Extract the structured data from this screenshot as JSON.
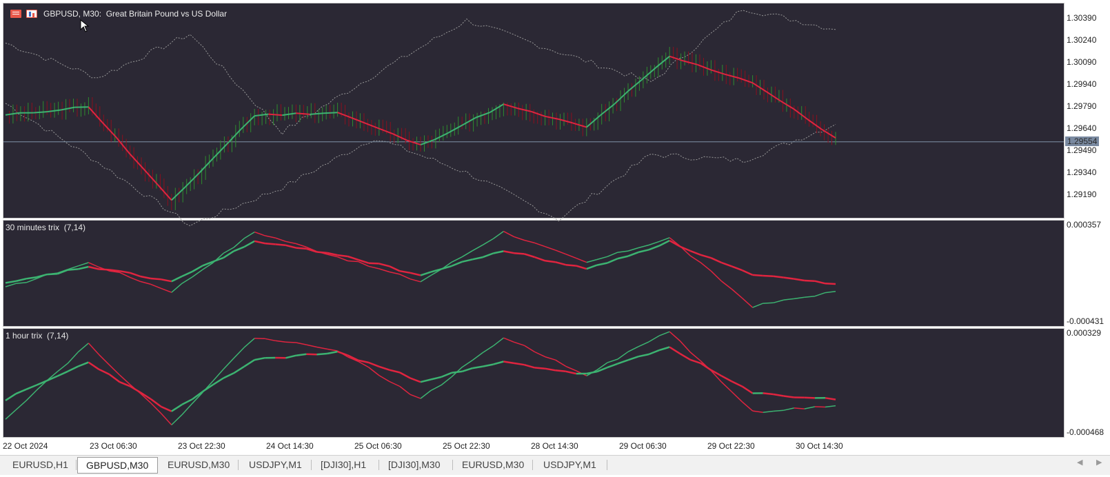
{
  "chart_title": "GBPUSD, M30:  Great Britain Pound vs US Dollar",
  "main_pane": {
    "price_labels": [
      "1.30390",
      "1.30240",
      "1.30090",
      "1.29940",
      "1.29790",
      "1.29640",
      "1.29490",
      "1.29340",
      "1.29190"
    ],
    "current_price": "1.29554"
  },
  "indicator_1": {
    "label": "30 minutes trix  (7,14)",
    "max_label": "0.000357",
    "min_label": "-0.000431"
  },
  "indicator_2": {
    "label": "1 hour trix  (7,14)",
    "max_label": "0.000329",
    "min_label": "-0.000468"
  },
  "time_labels": [
    "22 Oct 2024",
    "23 Oct 06:30",
    "23 Oct 22:30",
    "24 Oct 14:30",
    "25 Oct 06:30",
    "25 Oct 22:30",
    "28 Oct 14:30",
    "29 Oct 06:30",
    "29 Oct 22:30",
    "30 Oct 14:30"
  ],
  "tabs": [
    {
      "label": "EURUSD,H1",
      "active": false
    },
    {
      "label": "GBPUSD,M30",
      "active": true
    },
    {
      "label": "EURUSD,M30",
      "active": false
    },
    {
      "label": "USDJPY,M1",
      "active": false
    },
    {
      "label": "[DJI30],H1",
      "active": false
    },
    {
      "label": "[DJI30],M30",
      "active": false
    },
    {
      "label": "EURUSD,M30",
      "active": false
    },
    {
      "label": "USDJPY,M1",
      "active": false
    }
  ],
  "colors": {
    "background": "#2b2834",
    "bull": "#2e8b2e",
    "bear": "#8b0f1e",
    "line_up": "#3cb371",
    "line_down": "#e0243f",
    "band": "#9a9a9a",
    "price_line": "#7f93a8"
  },
  "chart_data": [
    {
      "type": "line",
      "title": "GBPUSD, M30:  Great Britain Pound vs US Dollar",
      "x": [
        "22 Oct 2024",
        "23 Oct 06:30",
        "23 Oct 22:30",
        "24 Oct 14:30",
        "25 Oct 06:30",
        "25 Oct 22:30",
        "28 Oct 14:30",
        "29 Oct 06:30",
        "29 Oct 22:30",
        "30 Oct 14:30",
        "30 Oct 19:30"
      ],
      "series": [
        {
          "values": [
            1.2973,
            1.2979,
            1.2916,
            1.2973,
            1.2975,
            1.2953,
            1.298,
            1.2965,
            1.3012,
            1.2995,
            1.2958
          ]
        }
      ],
      "upper_band": [
        1.3021,
        1.2998,
        1.3027,
        1.2962,
        1.3,
        1.3036,
        1.3015,
        1.2995,
        1.3044,
        1.303
      ],
      "lower_band": [
        1.2981,
        1.2942,
        1.29,
        1.2925,
        1.2958,
        1.2935,
        1.2904,
        1.2947,
        1.2943,
        1.2967
      ],
      "price_line": 1.29554,
      "ylim": [
        1.291,
        1.3045
      ],
      "yticks": [
        1.2919,
        1.2934,
        1.2949,
        1.2964,
        1.2979,
        1.2994,
        1.3009,
        1.3024,
        1.3039
      ]
    },
    {
      "type": "line",
      "title": "30 minutes trix  (7,14)",
      "x": [
        "22 Oct 2024",
        "23 Oct 06:30",
        "23 Oct 22:30",
        "24 Oct 14:30",
        "25 Oct 06:30",
        "25 Oct 22:30",
        "28 Oct 14:30",
        "29 Oct 06:30",
        "29 Oct 22:30",
        "30 Oct 14:30",
        "30 Oct 19:30"
      ],
      "series": [
        {
          "values": [
            -0.00015,
            5e-05,
            -0.00018,
            0.0003,
            0.0001,
            -0.0001,
            0.0003,
            5e-05,
            0.00025,
            -0.0003,
            -0.00018
          ]
        },
        {
          "values": [
            -0.00012,
            2e-05,
            -0.0001,
            0.00022,
            0.00012,
            -5e-05,
            0.00015,
            0.0,
            0.00022,
            -5e-05,
            -0.00012
          ]
        }
      ],
      "ylim": [
        -0.000431,
        0.000357
      ]
    },
    {
      "type": "line",
      "title": "1 hour trix  (7,14)",
      "x": [
        "22 Oct 2024",
        "23 Oct 06:30",
        "23 Oct 22:30",
        "24 Oct 14:30",
        "25 Oct 06:30",
        "25 Oct 22:30",
        "28 Oct 14:30",
        "29 Oct 06:30",
        "29 Oct 22:30",
        "30 Oct 14:30",
        "30 Oct 19:30"
      ],
      "series": [
        {
          "values": [
            -0.00035,
            0.00025,
            -0.0004,
            0.0003,
            0.0002,
            -0.0002,
            0.0003,
            0.0,
            0.00035,
            -0.0003,
            -0.00025
          ]
        },
        {
          "values": [
            -0.0002,
            0.0001,
            -0.0003,
            0.00012,
            0.00018,
            -5e-05,
            0.0001,
            0.0,
            0.00022,
            -0.00015,
            -0.0002
          ]
        }
      ],
      "ylim": [
        -0.000468,
        0.000329
      ]
    }
  ]
}
